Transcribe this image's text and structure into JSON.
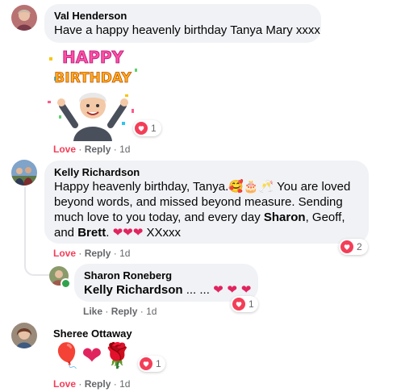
{
  "comments": [
    {
      "author": "Val Henderson",
      "text": "Have a happy heavenly birthday Tanya Mary xxxx",
      "sticker": {
        "line1": "HAPPY",
        "line2": "BIRTHDAY"
      },
      "reaction_count": "1",
      "actions": {
        "reaction": "Love",
        "reply": "Reply",
        "time": "1d"
      }
    },
    {
      "author": "Kelly Richardson",
      "text_parts": [
        "Happy heavenly birthday, Tanya.",
        "🥰🎂🥂",
        " You are loved beyond words, and missed beyond measure. Sending much love to you today, and every day ",
        "Sharon",
        ", Geoff, and ",
        "Brett",
        ". ",
        "❤❤❤",
        " XXxxx"
      ],
      "reaction_count": "2",
      "actions": {
        "reaction": "Love",
        "reply": "Reply",
        "time": "1d"
      },
      "reply": {
        "author": "Sharon Roneberg",
        "mention": "Kelly Richardson",
        "text": " ... ... ",
        "hearts": "❤ ❤ ❤",
        "reaction_count": "1",
        "actions": {
          "reaction": "Like",
          "reply": "Reply",
          "time": "1d"
        }
      }
    },
    {
      "author": "Sheree Ottaway",
      "emojis": "🎈❤🌹",
      "reaction_count": "1",
      "actions": {
        "reaction": "Love",
        "reply": "Reply",
        "time": "1d"
      }
    }
  ],
  "colors": {
    "bubble": "#f0f2f5",
    "love": "#f33e58",
    "meta": "#65676b",
    "online": "#31a24c"
  }
}
